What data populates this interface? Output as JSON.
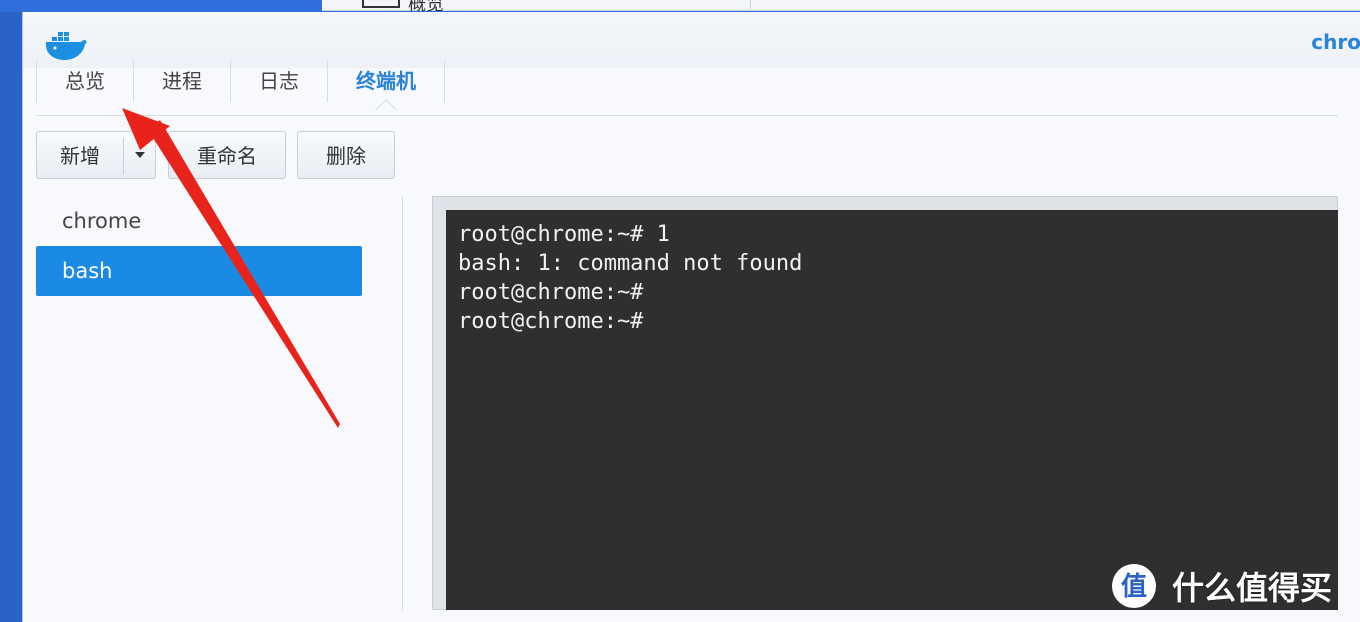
{
  "background_window": {
    "title": "概览"
  },
  "window": {
    "title": "chro",
    "app_icon": "docker-whale-icon"
  },
  "tabs": [
    {
      "label": "总览",
      "active": false
    },
    {
      "label": "进程",
      "active": false
    },
    {
      "label": "日志",
      "active": false
    },
    {
      "label": "终端机",
      "active": true
    }
  ],
  "toolbar": {
    "new_label": "新增",
    "rename_label": "重命名",
    "delete_label": "删除"
  },
  "sessions": [
    {
      "label": "chrome",
      "selected": false
    },
    {
      "label": "bash",
      "selected": true
    }
  ],
  "terminal": {
    "lines": [
      "root@chrome:~# 1",
      "bash: 1: command not found",
      "root@chrome:~#",
      "root@chrome:~#"
    ]
  },
  "watermark": {
    "text": "什么值得买",
    "logo": "smzdm-logo-icon"
  },
  "colors": {
    "accent": "#2b82d9",
    "selection": "#1b8ae5",
    "terminal_bg": "#2f2f2f",
    "annotation": "#e8231b"
  }
}
